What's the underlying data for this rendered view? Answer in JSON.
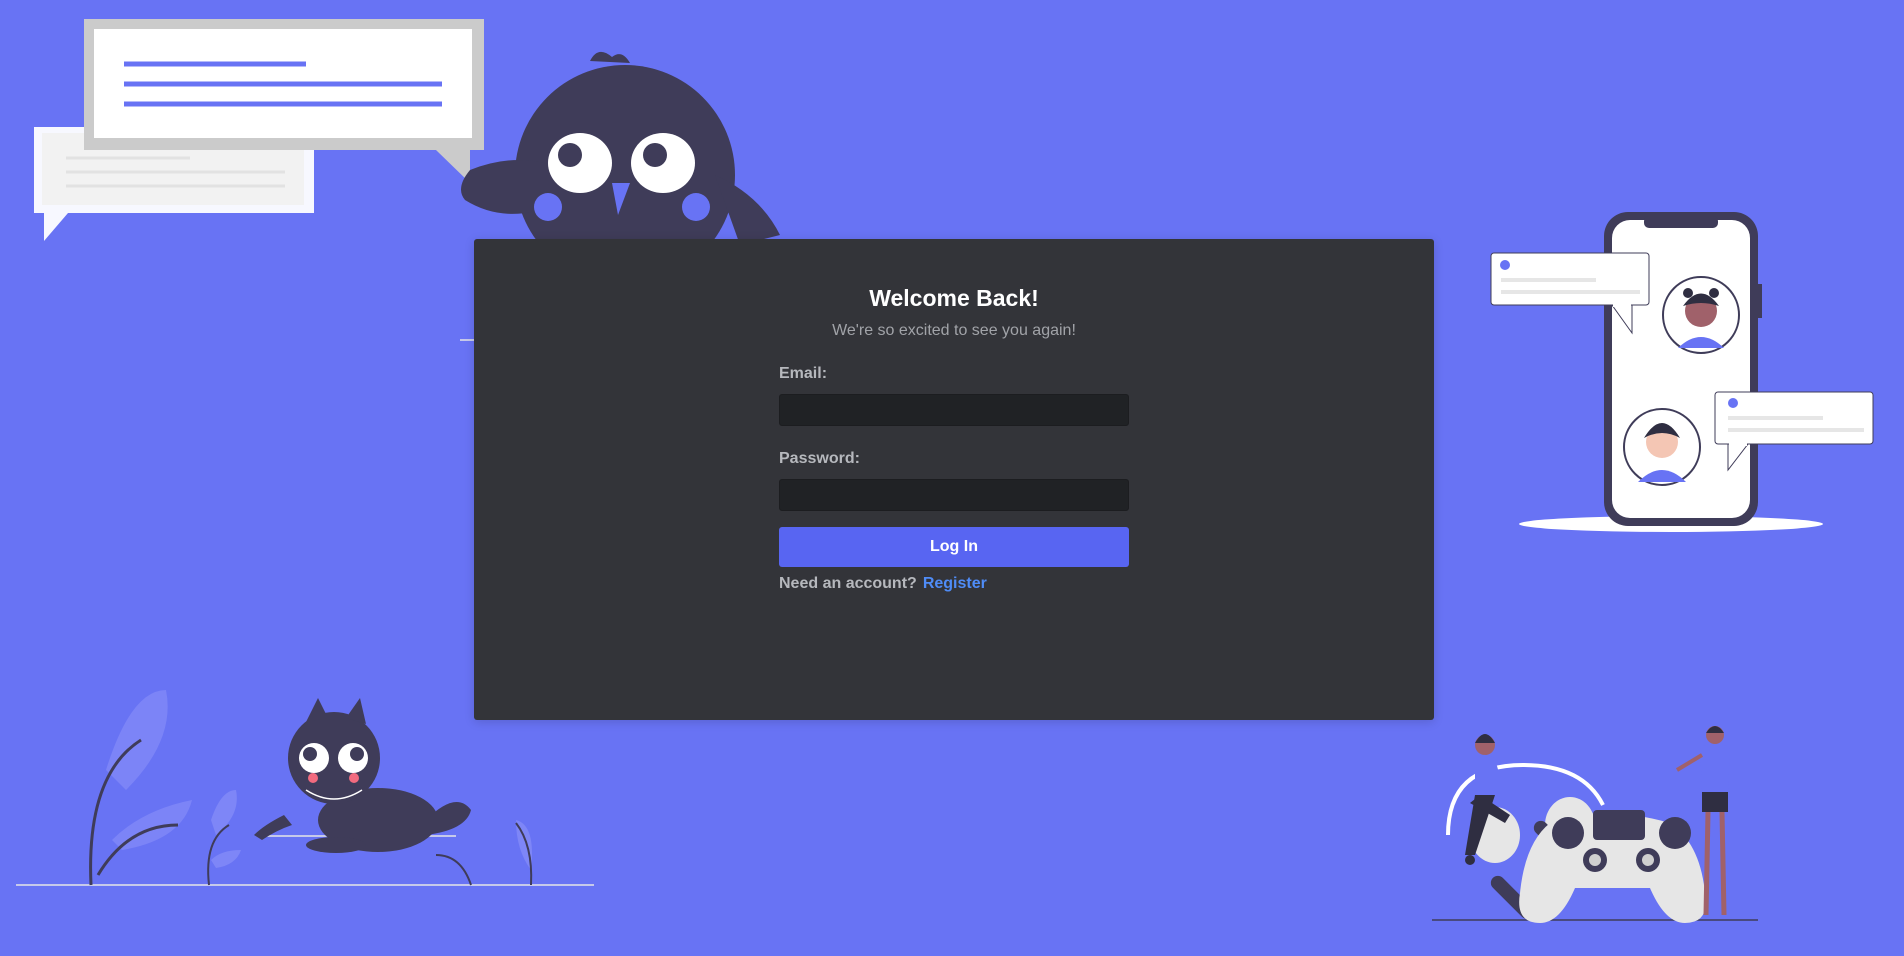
{
  "login": {
    "title": "Welcome Back!",
    "subtitle": "We're so excited to see you again!",
    "email_label": "Email:",
    "email_value": "",
    "password_label": "Password:",
    "password_value": "",
    "login_button": "Log In",
    "register_prompt": "Need an account?",
    "register_link": "Register"
  },
  "colors": {
    "background": "#6873f4",
    "card": "#333439",
    "input": "#202225",
    "button": "#5865f2",
    "link": "#4f8cf7"
  },
  "icons": [
    "chat-bubbles-illustration",
    "bird-mascot-illustration",
    "phone-chat-illustration",
    "cat-mascot-illustration",
    "gamer-controller-illustration"
  ]
}
